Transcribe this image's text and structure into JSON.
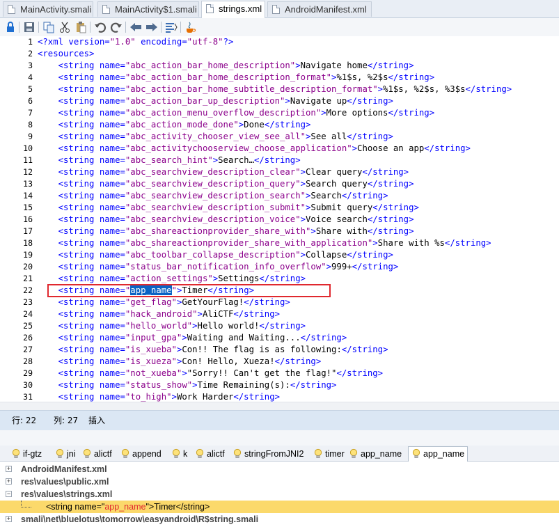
{
  "tabs": [
    {
      "label": "MainActivity.smali",
      "active": false
    },
    {
      "label": "MainActivity$1.smali",
      "active": false
    },
    {
      "label": "strings.xml",
      "active": true
    },
    {
      "label": "AndroidManifest.xml",
      "active": false
    }
  ],
  "toolbar": {
    "icons": [
      "lock-icon",
      "save-icon",
      "copy-icon",
      "cut-icon",
      "paste-icon",
      "undo-icon",
      "redo-icon",
      "back-icon",
      "forward-icon",
      "format-icon",
      "java-icon"
    ]
  },
  "editor": {
    "lines": [
      {
        "n": "1",
        "parts": [
          [
            "tag",
            "<?xml "
          ],
          [
            "attr",
            "version="
          ],
          [
            "val",
            "\"1.0\""
          ],
          [
            "attr",
            " encoding="
          ],
          [
            "val",
            "\"utf-8\""
          ],
          [
            "tag",
            "?>"
          ]
        ]
      },
      {
        "n": "2",
        "parts": [
          [
            "tag",
            "<resources>"
          ]
        ]
      },
      {
        "n": "3",
        "parts": [
          [
            "text",
            "    "
          ],
          [
            "tag",
            "<string "
          ],
          [
            "attr",
            "name="
          ],
          [
            "val",
            "\"abc_action_bar_home_description\""
          ],
          [
            "tag",
            ">"
          ],
          [
            "text",
            "Navigate home"
          ],
          [
            "tag",
            "</string>"
          ]
        ]
      },
      {
        "n": "4",
        "parts": [
          [
            "text",
            "    "
          ],
          [
            "tag",
            "<string "
          ],
          [
            "attr",
            "name="
          ],
          [
            "val",
            "\"abc_action_bar_home_description_format\""
          ],
          [
            "tag",
            ">"
          ],
          [
            "text",
            "%1$s, %2$s"
          ],
          [
            "tag",
            "</string>"
          ]
        ]
      },
      {
        "n": "5",
        "parts": [
          [
            "text",
            "    "
          ],
          [
            "tag",
            "<string "
          ],
          [
            "attr",
            "name="
          ],
          [
            "val",
            "\"abc_action_bar_home_subtitle_description_format\""
          ],
          [
            "tag",
            ">"
          ],
          [
            "text",
            "%1$s, %2$s, %3$s"
          ],
          [
            "tag",
            "</string>"
          ]
        ]
      },
      {
        "n": "6",
        "parts": [
          [
            "text",
            "    "
          ],
          [
            "tag",
            "<string "
          ],
          [
            "attr",
            "name="
          ],
          [
            "val",
            "\"abc_action_bar_up_description\""
          ],
          [
            "tag",
            ">"
          ],
          [
            "text",
            "Navigate up"
          ],
          [
            "tag",
            "</string>"
          ]
        ]
      },
      {
        "n": "7",
        "parts": [
          [
            "text",
            "    "
          ],
          [
            "tag",
            "<string "
          ],
          [
            "attr",
            "name="
          ],
          [
            "val",
            "\"abc_action_menu_overflow_description\""
          ],
          [
            "tag",
            ">"
          ],
          [
            "text",
            "More options"
          ],
          [
            "tag",
            "</string>"
          ]
        ]
      },
      {
        "n": "8",
        "parts": [
          [
            "text",
            "    "
          ],
          [
            "tag",
            "<string "
          ],
          [
            "attr",
            "name="
          ],
          [
            "val",
            "\"abc_action_mode_done\""
          ],
          [
            "tag",
            ">"
          ],
          [
            "text",
            "Done"
          ],
          [
            "tag",
            "</string>"
          ]
        ]
      },
      {
        "n": "9",
        "parts": [
          [
            "text",
            "    "
          ],
          [
            "tag",
            "<string "
          ],
          [
            "attr",
            "name="
          ],
          [
            "val",
            "\"abc_activity_chooser_view_see_all\""
          ],
          [
            "tag",
            ">"
          ],
          [
            "text",
            "See all"
          ],
          [
            "tag",
            "</string>"
          ]
        ]
      },
      {
        "n": "10",
        "parts": [
          [
            "text",
            "    "
          ],
          [
            "tag",
            "<string "
          ],
          [
            "attr",
            "name="
          ],
          [
            "val",
            "\"abc_activitychooserview_choose_application\""
          ],
          [
            "tag",
            ">"
          ],
          [
            "text",
            "Choose an app"
          ],
          [
            "tag",
            "</string>"
          ]
        ]
      },
      {
        "n": "11",
        "parts": [
          [
            "text",
            "    "
          ],
          [
            "tag",
            "<string "
          ],
          [
            "attr",
            "name="
          ],
          [
            "val",
            "\"abc_search_hint\""
          ],
          [
            "tag",
            ">"
          ],
          [
            "text",
            "Search…"
          ],
          [
            "tag",
            "</string>"
          ]
        ]
      },
      {
        "n": "12",
        "parts": [
          [
            "text",
            "    "
          ],
          [
            "tag",
            "<string "
          ],
          [
            "attr",
            "name="
          ],
          [
            "val",
            "\"abc_searchview_description_clear\""
          ],
          [
            "tag",
            ">"
          ],
          [
            "text",
            "Clear query"
          ],
          [
            "tag",
            "</string>"
          ]
        ]
      },
      {
        "n": "13",
        "parts": [
          [
            "text",
            "    "
          ],
          [
            "tag",
            "<string "
          ],
          [
            "attr",
            "name="
          ],
          [
            "val",
            "\"abc_searchview_description_query\""
          ],
          [
            "tag",
            ">"
          ],
          [
            "text",
            "Search query"
          ],
          [
            "tag",
            "</string>"
          ]
        ]
      },
      {
        "n": "14",
        "parts": [
          [
            "text",
            "    "
          ],
          [
            "tag",
            "<string "
          ],
          [
            "attr",
            "name="
          ],
          [
            "val",
            "\"abc_searchview_description_search\""
          ],
          [
            "tag",
            ">"
          ],
          [
            "text",
            "Search"
          ],
          [
            "tag",
            "</string>"
          ]
        ]
      },
      {
        "n": "15",
        "parts": [
          [
            "text",
            "    "
          ],
          [
            "tag",
            "<string "
          ],
          [
            "attr",
            "name="
          ],
          [
            "val",
            "\"abc_searchview_description_submit\""
          ],
          [
            "tag",
            ">"
          ],
          [
            "text",
            "Submit query"
          ],
          [
            "tag",
            "</string>"
          ]
        ]
      },
      {
        "n": "16",
        "parts": [
          [
            "text",
            "    "
          ],
          [
            "tag",
            "<string "
          ],
          [
            "attr",
            "name="
          ],
          [
            "val",
            "\"abc_searchview_description_voice\""
          ],
          [
            "tag",
            ">"
          ],
          [
            "text",
            "Voice search"
          ],
          [
            "tag",
            "</string>"
          ]
        ]
      },
      {
        "n": "17",
        "parts": [
          [
            "text",
            "    "
          ],
          [
            "tag",
            "<string "
          ],
          [
            "attr",
            "name="
          ],
          [
            "val",
            "\"abc_shareactionprovider_share_with\""
          ],
          [
            "tag",
            ">"
          ],
          [
            "text",
            "Share with"
          ],
          [
            "tag",
            "</string>"
          ]
        ]
      },
      {
        "n": "18",
        "parts": [
          [
            "text",
            "    "
          ],
          [
            "tag",
            "<string "
          ],
          [
            "attr",
            "name="
          ],
          [
            "val",
            "\"abc_shareactionprovider_share_with_application\""
          ],
          [
            "tag",
            ">"
          ],
          [
            "text",
            "Share with %s"
          ],
          [
            "tag",
            "</string>"
          ]
        ]
      },
      {
        "n": "19",
        "parts": [
          [
            "text",
            "    "
          ],
          [
            "tag",
            "<string "
          ],
          [
            "attr",
            "name="
          ],
          [
            "val",
            "\"abc_toolbar_collapse_description\""
          ],
          [
            "tag",
            ">"
          ],
          [
            "text",
            "Collapse"
          ],
          [
            "tag",
            "</string>"
          ]
        ]
      },
      {
        "n": "20",
        "parts": [
          [
            "text",
            "    "
          ],
          [
            "tag",
            "<string "
          ],
          [
            "attr",
            "name="
          ],
          [
            "val",
            "\"status_bar_notification_info_overflow\""
          ],
          [
            "tag",
            ">"
          ],
          [
            "text",
            "999+"
          ],
          [
            "tag",
            "</string>"
          ]
        ]
      },
      {
        "n": "21",
        "parts": [
          [
            "text",
            "    "
          ],
          [
            "tag",
            "<string "
          ],
          [
            "attr",
            "name="
          ],
          [
            "val",
            "\"action_settings\""
          ],
          [
            "tag",
            ">"
          ],
          [
            "text",
            "Settings"
          ],
          [
            "tag",
            "</string>"
          ]
        ]
      },
      {
        "n": "22",
        "parts": [
          [
            "text",
            "    "
          ],
          [
            "tag",
            "<string "
          ],
          [
            "attr",
            "name="
          ],
          [
            "val",
            "\""
          ],
          [
            "sel",
            "app_name"
          ],
          [
            "val",
            "\""
          ],
          [
            "tag",
            ">"
          ],
          [
            "text",
            "Timer"
          ],
          [
            "tag",
            "</string>"
          ]
        ]
      },
      {
        "n": "23",
        "parts": [
          [
            "text",
            "    "
          ],
          [
            "tag",
            "<string "
          ],
          [
            "attr",
            "name="
          ],
          [
            "val",
            "\"get_flag\""
          ],
          [
            "tag",
            ">"
          ],
          [
            "text",
            "GetYourFlag!"
          ],
          [
            "tag",
            "</string>"
          ]
        ]
      },
      {
        "n": "24",
        "parts": [
          [
            "text",
            "    "
          ],
          [
            "tag",
            "<string "
          ],
          [
            "attr",
            "name="
          ],
          [
            "val",
            "\"hack_android\""
          ],
          [
            "tag",
            ">"
          ],
          [
            "text",
            "AliCTF"
          ],
          [
            "tag",
            "</string>"
          ]
        ]
      },
      {
        "n": "25",
        "parts": [
          [
            "text",
            "    "
          ],
          [
            "tag",
            "<string "
          ],
          [
            "attr",
            "name="
          ],
          [
            "val",
            "\"hello_world\""
          ],
          [
            "tag",
            ">"
          ],
          [
            "text",
            "Hello world!"
          ],
          [
            "tag",
            "</string>"
          ]
        ]
      },
      {
        "n": "26",
        "parts": [
          [
            "text",
            "    "
          ],
          [
            "tag",
            "<string "
          ],
          [
            "attr",
            "name="
          ],
          [
            "val",
            "\"input_gpa\""
          ],
          [
            "tag",
            ">"
          ],
          [
            "text",
            "Waiting and Waiting..."
          ],
          [
            "tag",
            "</string>"
          ]
        ]
      },
      {
        "n": "27",
        "parts": [
          [
            "text",
            "    "
          ],
          [
            "tag",
            "<string "
          ],
          [
            "attr",
            "name="
          ],
          [
            "val",
            "\"is_xueba\""
          ],
          [
            "tag",
            ">"
          ],
          [
            "text",
            "Con!! The flag is as following:"
          ],
          [
            "tag",
            "</string>"
          ]
        ]
      },
      {
        "n": "28",
        "parts": [
          [
            "text",
            "    "
          ],
          [
            "tag",
            "<string "
          ],
          [
            "attr",
            "name="
          ],
          [
            "val",
            "\"is_xueza\""
          ],
          [
            "tag",
            ">"
          ],
          [
            "text",
            "Con! Hello, Xueza!"
          ],
          [
            "tag",
            "</string>"
          ]
        ]
      },
      {
        "n": "29",
        "parts": [
          [
            "text",
            "    "
          ],
          [
            "tag",
            "<string "
          ],
          [
            "attr",
            "name="
          ],
          [
            "val",
            "\"not_xueba\""
          ],
          [
            "tag",
            ">"
          ],
          [
            "text",
            "\"Sorry!! Can't get the flag!\""
          ],
          [
            "tag",
            "</string>"
          ]
        ]
      },
      {
        "n": "30",
        "parts": [
          [
            "text",
            "    "
          ],
          [
            "tag",
            "<string "
          ],
          [
            "attr",
            "name="
          ],
          [
            "val",
            "\"status_show\""
          ],
          [
            "tag",
            ">"
          ],
          [
            "text",
            "Time Remaining(s):"
          ],
          [
            "tag",
            "</string>"
          ]
        ]
      },
      {
        "n": "31",
        "parts": [
          [
            "text",
            "    "
          ],
          [
            "tag",
            "<string "
          ],
          [
            "attr",
            "name="
          ],
          [
            "val",
            "\"to_high\""
          ],
          [
            "tag",
            ">"
          ],
          [
            "text",
            "Work Harder"
          ],
          [
            "tag",
            "</string>"
          ]
        ]
      }
    ]
  },
  "status": {
    "row": "行: 22",
    "col": "列: 27",
    "mode": "插入"
  },
  "bookmarks": [
    {
      "label": "if-gtz",
      "active": false
    },
    {
      "label": "jni",
      "active": false
    },
    {
      "label": "alictf",
      "active": false
    },
    {
      "label": "append",
      "active": false
    },
    {
      "label": "k",
      "active": false
    },
    {
      "label": "alictf",
      "active": false
    },
    {
      "label": "stringFromJNI2",
      "active": false
    },
    {
      "label": "timer",
      "active": false
    },
    {
      "label": "app_name",
      "active": false
    },
    {
      "label": "app_name",
      "active": true
    }
  ],
  "results": {
    "rows": [
      {
        "label": "AndroidManifest.xml",
        "expander": "+"
      },
      {
        "label": "res\\values\\public.xml",
        "expander": "+"
      },
      {
        "label": "res\\values\\strings.xml",
        "expander": "−"
      },
      {
        "match_before": "<string name=\"",
        "match_hit": "app_name",
        "match_after": "\">Timer</string>"
      },
      {
        "label": "smali\\net\\bluelotus\\tomorrow\\easyandroid\\R$string.smali",
        "expander": "+"
      }
    ]
  },
  "colors": {
    "selection": "#0a63c4",
    "highlight_box": "#e0282e",
    "match_row": "#fbd96b",
    "tag": "#0000ff",
    "value": "#8b008b"
  }
}
